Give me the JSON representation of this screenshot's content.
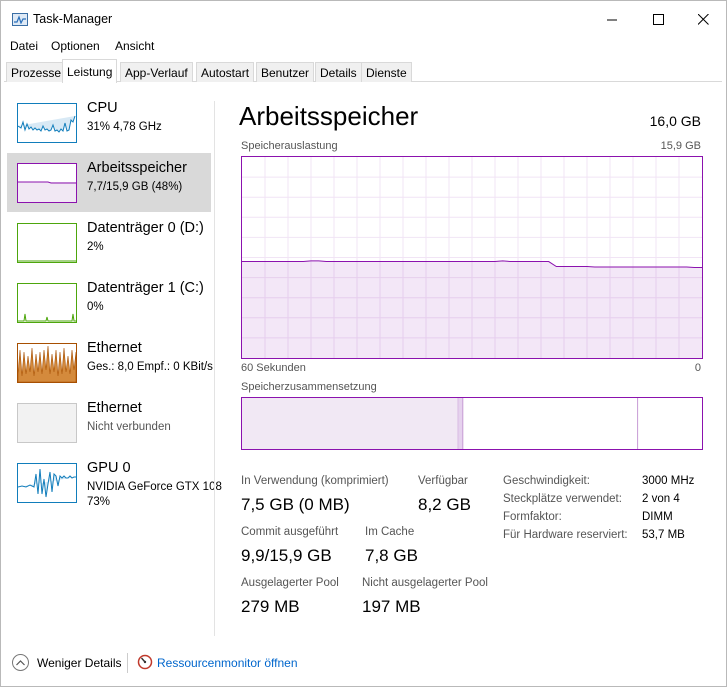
{
  "window": {
    "title": "Task-Manager",
    "minimize": "—",
    "maximize": "☐",
    "close": "✕"
  },
  "menu": [
    "Datei",
    "Optionen",
    "Ansicht"
  ],
  "tabs": [
    "Prozesse",
    "Leistung",
    "App-Verlauf",
    "Autostart",
    "Benutzer",
    "Details",
    "Dienste"
  ],
  "active_tab": "Leistung",
  "resources": [
    {
      "name": "CPU",
      "line1": "31% 4,78 GHz",
      "line2": "",
      "color": "#117dbb"
    },
    {
      "name": "Arbeitsspeicher",
      "line1": "7,7/15,9 GB (48%)",
      "line2": "",
      "color": "#8b12ae"
    },
    {
      "name": "Datenträger 0 (D:)",
      "line1": "2%",
      "line2": "",
      "color": "#4da60c"
    },
    {
      "name": "Datenträger 1 (C:)",
      "line1": "0%",
      "line2": "",
      "color": "#4da60c"
    },
    {
      "name": "Ethernet",
      "line1": "Ges.: 8,0  Empf.: 0 KBit/s",
      "line2": "",
      "color": "#a74f01"
    },
    {
      "name": "Ethernet",
      "line1": "Nicht verbunden",
      "line2": "",
      "color": "#a5a5a5"
    },
    {
      "name": "GPU 0",
      "line1": "NVIDIA GeForce GTX 108",
      "line2": "73%",
      "color": "#117dbb"
    }
  ],
  "main": {
    "title": "Arbeitsspeicher",
    "total": "16,0 GB",
    "usage_label": "Speicherauslastung",
    "usage_max": "15,9 GB",
    "time_label": "60 Sekunden",
    "time_end": "0",
    "composition_label": "Speicherzusammensetzung"
  },
  "stats": {
    "in_use_label": "In Verwendung (komprimiert)",
    "in_use_value": "7,5 GB (0 MB)",
    "available_label": "Verfügbar",
    "available_value": "8,2 GB",
    "commit_label": "Commit ausgeführt",
    "commit_value": "9,9/15,9 GB",
    "cache_label": "Im Cache",
    "cache_value": "7,8 GB",
    "paged_label": "Ausgelagerter Pool",
    "paged_value": "279 MB",
    "nonpaged_label": "Nicht ausgelagerter Pool",
    "nonpaged_value": "197 MB"
  },
  "specs": [
    {
      "key": "Geschwindigkeit:",
      "value": "3000 MHz"
    },
    {
      "key": "Steckplätze verwendet:",
      "value": "2 von 4"
    },
    {
      "key": "Formfaktor:",
      "value": "DIMM"
    },
    {
      "key": "Für Hardware reserviert:",
      "value": "53,7 MB"
    }
  ],
  "footer": {
    "fewer_details": "Weniger Details",
    "resource_monitor": "Ressourcenmonitor öffnen"
  },
  "memory_usage_history": [
    48,
    48,
    48,
    48,
    48,
    48,
    48,
    48,
    48,
    48.3,
    48.3,
    48,
    48,
    48,
    48,
    48,
    48,
    48,
    48,
    48,
    48,
    48,
    48,
    48,
    48,
    48,
    48,
    48,
    48,
    48,
    48,
    48,
    48,
    48,
    48.3,
    48,
    48,
    48,
    48,
    48,
    48,
    45.5,
    45.5,
    45.5,
    45.5,
    45.5,
    45.3,
    45.3,
    45.3,
    45.3,
    45.3,
    45.3,
    45.3,
    45.3,
    45.3,
    45.3,
    45.3,
    45.3,
    45.3,
    45,
    45
  ],
  "composition": {
    "in_use": 0.47,
    "modified": 0.01,
    "standby": 0.86,
    "free": 0.14
  }
}
